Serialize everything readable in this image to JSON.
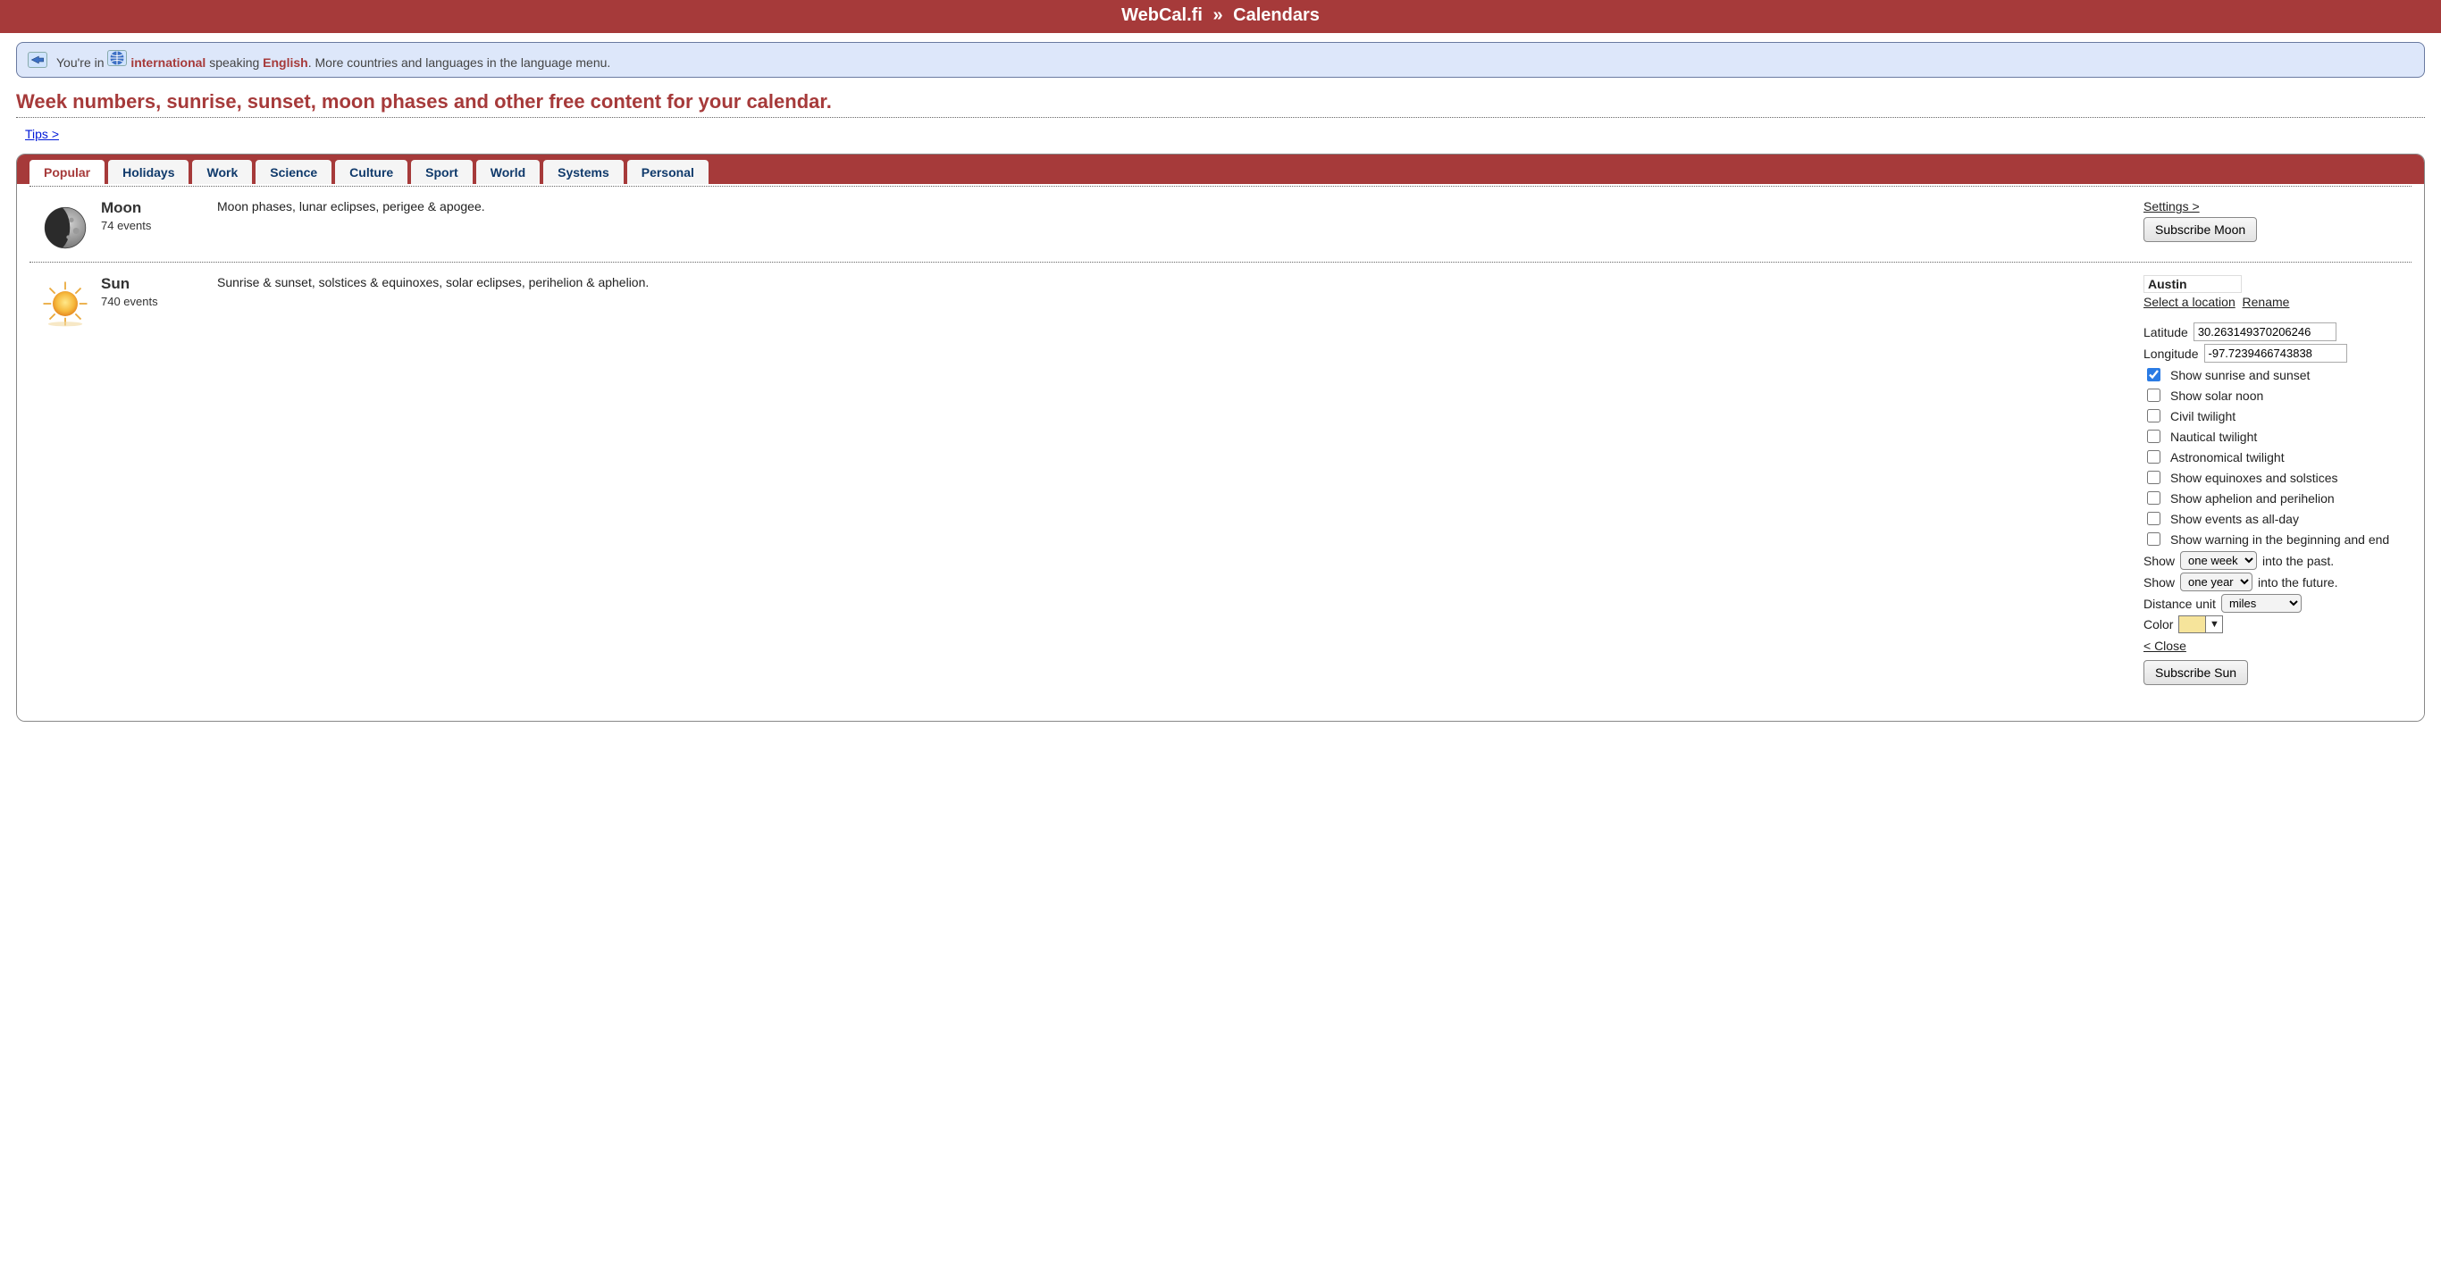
{
  "title_site": "WebCal.fi",
  "title_section": "Calendars",
  "notice": {
    "prefix": "You're in ",
    "country": "international",
    "speaking": " speaking ",
    "language": "English",
    "suffix": ". More countries and languages in the language menu."
  },
  "tagline": "Week numbers, sunrise, sunset, moon phases and other free content for your calendar.",
  "tips_link": "Tips >",
  "tabs": [
    "Popular",
    "Holidays",
    "Work",
    "Science",
    "Culture",
    "Sport",
    "World",
    "Systems",
    "Personal"
  ],
  "active_tab_index": 0,
  "moon": {
    "title": "Moon",
    "count": "74 events",
    "desc": "Moon phases, lunar eclipses, perigee & apogee.",
    "settings_link": "Settings >",
    "subscribe": "Subscribe Moon"
  },
  "sun": {
    "title": "Sun",
    "count": "740 events",
    "desc": "Sunrise & sunset, solstices & equinoxes, solar eclipses, perihelion & aphelion.",
    "location_name": "Austin",
    "select_location": "Select a location",
    "rename": "Rename",
    "lat_label": "Latitude",
    "lat_value": "30.263149370206246",
    "lon_label": "Longitude",
    "lon_value": "-97.7239466743838",
    "opts": [
      {
        "label": "Show sunrise and sunset",
        "checked": true
      },
      {
        "label": "Show solar noon",
        "checked": false
      },
      {
        "label": "Civil twilight",
        "checked": false
      },
      {
        "label": "Nautical twilight",
        "checked": false
      },
      {
        "label": "Astronomical twilight",
        "checked": false
      },
      {
        "label": "Show equinoxes and solstices",
        "checked": false
      },
      {
        "label": "Show aphelion and perihelion",
        "checked": false
      },
      {
        "label": "Show events as all-day",
        "checked": false
      },
      {
        "label": "Show warning in the beginning and end",
        "checked": false
      }
    ],
    "show_label": "Show",
    "past_value": "one week",
    "past_suffix": "into the past.",
    "future_value": "one year",
    "future_suffix": "into the future.",
    "distance_label": "Distance unit",
    "distance_value": "miles",
    "color_label": "Color",
    "color_value": "#f6e49b",
    "close": "< Close",
    "subscribe": "Subscribe Sun"
  }
}
